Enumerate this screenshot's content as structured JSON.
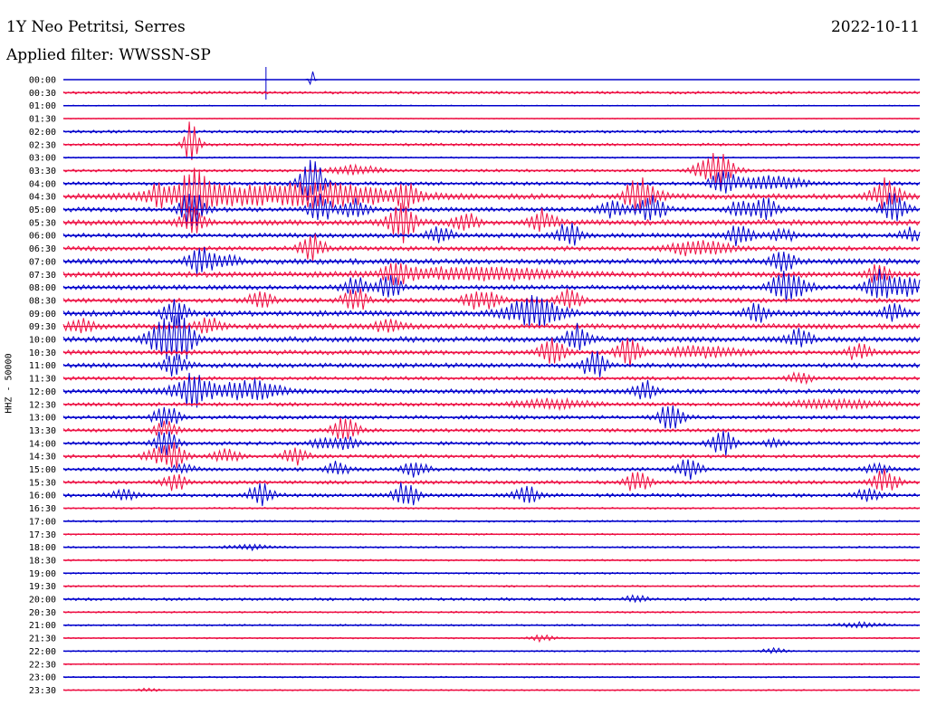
{
  "header": {
    "station": "1Y Neo Petritsi, Serres",
    "date": "2022-10-11",
    "filter": "Applied filter: WWSSN-SP"
  },
  "chart_data": {
    "type": "line",
    "title": "1Y Neo Petritsi, Serres",
    "ylabel": "HHZ - 50000",
    "colors": [
      "#0000cc",
      "#ee1144"
    ],
    "times": [
      "00:00",
      "00:30",
      "01:00",
      "01:30",
      "02:00",
      "02:30",
      "03:00",
      "03:30",
      "04:00",
      "04:30",
      "05:00",
      "05:30",
      "06:00",
      "06:30",
      "07:00",
      "07:30",
      "08:00",
      "08:30",
      "09:00",
      "09:30",
      "10:00",
      "10:30",
      "11:00",
      "11:30",
      "12:00",
      "12:30",
      "13:00",
      "13:30",
      "14:00",
      "14:30",
      "15:00",
      "15:30",
      "16:00",
      "16:30",
      "17:00",
      "17:30",
      "18:00",
      "18:30",
      "19:00",
      "19:30",
      "20:00",
      "20:30",
      "21:00",
      "21:30",
      "22:00",
      "22:30",
      "23:00",
      "23:30"
    ],
    "noise": [
      0,
      1.5,
      0.5,
      0.5,
      1.5,
      1.5,
      0.8,
      1.5,
      2,
      3,
      2.5,
      3,
      2.5,
      2.5,
      3,
      3,
      2.5,
      2.5,
      3,
      3,
      3,
      2.5,
      2.5,
      2,
      2.5,
      2,
      2,
      2,
      2,
      2,
      2,
      2,
      2,
      1,
      1,
      1,
      1,
      1,
      1,
      1,
      1.5,
      1,
      1,
      0.8,
      0.8,
      0.8,
      0.8,
      0.8
    ],
    "events": [
      [
        [
          0.29,
          -12,
          0,
          0.002
        ]
      ],
      [],
      [],
      [],
      [],
      [
        [
          0.15,
          28,
          6,
          0.006
        ]
      ],
      [],
      [
        [
          0.34,
          6,
          3,
          0.02
        ],
        [
          0.76,
          22,
          12,
          0.015
        ]
      ],
      [
        [
          0.29,
          28,
          8,
          0.01
        ],
        [
          0.77,
          14,
          8,
          0.01
        ],
        [
          0.8,
          6,
          4,
          0.02
        ],
        [
          0.84,
          7,
          4,
          0.02
        ]
      ],
      [
        [
          0.11,
          12,
          8,
          0.01
        ],
        [
          0.15,
          25,
          12,
          0.012
        ],
        [
          0.17,
          8,
          4,
          0.02
        ],
        [
          0.25,
          10,
          4,
          0.09
        ],
        [
          0.32,
          8,
          4,
          0.05
        ],
        [
          0.4,
          12,
          10,
          0.01
        ],
        [
          0.67,
          22,
          14,
          0.01
        ],
        [
          0.69,
          6,
          5,
          0.01
        ],
        [
          0.96,
          20,
          12,
          0.012
        ]
      ],
      [
        [
          0.15,
          25,
          15,
          0.01
        ],
        [
          0.3,
          16,
          10,
          0.01
        ],
        [
          0.34,
          12,
          8,
          0.01
        ],
        [
          0.64,
          12,
          6,
          0.01
        ],
        [
          0.68,
          8,
          6,
          0.01
        ],
        [
          0.69,
          10,
          6,
          0.01
        ],
        [
          0.79,
          10,
          8,
          0.01
        ],
        [
          0.82,
          12,
          8,
          0.01
        ],
        [
          0.97,
          20,
          4,
          0.01
        ]
      ],
      [
        [
          0.15,
          18,
          12,
          0.01
        ],
        [
          0.39,
          16,
          12,
          0.01
        ],
        [
          0.4,
          12,
          8,
          0.01
        ],
        [
          0.47,
          10,
          6,
          0.01
        ],
        [
          0.56,
          14,
          10,
          0.01
        ]
      ],
      [
        [
          0.44,
          12,
          8,
          0.01
        ],
        [
          0.59,
          14,
          10,
          0.01
        ],
        [
          0.79,
          14,
          10,
          0.01
        ],
        [
          0.84,
          8,
          4,
          0.01
        ],
        [
          0.99,
          8,
          4,
          0.01
        ]
      ],
      [
        [
          0.29,
          16,
          12,
          0.01
        ],
        [
          0.73,
          6,
          3,
          0.02
        ],
        [
          0.76,
          5,
          3,
          0.02
        ]
      ],
      [
        [
          0.16,
          18,
          10,
          0.01
        ],
        [
          0.19,
          8,
          5,
          0.01
        ],
        [
          0.84,
          14,
          10,
          0.01
        ]
      ],
      [
        [
          0.39,
          12,
          8,
          0.01
        ],
        [
          0.45,
          6,
          4,
          0.06
        ],
        [
          0.53,
          4,
          3,
          0.04
        ],
        [
          0.95,
          10,
          6,
          0.01
        ]
      ],
      [
        [
          0.34,
          12,
          8,
          0.01
        ],
        [
          0.38,
          16,
          12,
          0.01
        ],
        [
          0.84,
          20,
          12,
          0.01
        ],
        [
          0.86,
          10,
          6,
          0.01
        ],
        [
          0.95,
          18,
          12,
          0.01
        ],
        [
          0.97,
          10,
          8,
          0.01
        ],
        [
          0.99,
          10,
          8,
          0.01
        ]
      ],
      [
        [
          0.23,
          12,
          8,
          0.01
        ],
        [
          0.34,
          16,
          12,
          0.01
        ],
        [
          0.48,
          10,
          6,
          0.01
        ],
        [
          0.5,
          8,
          5,
          0.01
        ],
        [
          0.59,
          12,
          8,
          0.01
        ]
      ],
      [
        [
          0.13,
          16,
          12,
          0.01
        ],
        [
          0.54,
          12,
          10,
          0.02
        ],
        [
          0.56,
          10,
          8,
          0.02
        ],
        [
          0.81,
          12,
          10,
          0.01
        ],
        [
          0.97,
          10,
          8,
          0.01
        ]
      ],
      [
        [
          0.02,
          8,
          4,
          0.01
        ],
        [
          0.17,
          10,
          8,
          0.01
        ],
        [
          0.38,
          8,
          5,
          0.01
        ]
      ],
      [
        [
          0.12,
          22,
          18,
          0.015
        ],
        [
          0.14,
          20,
          12,
          0.01
        ],
        [
          0.6,
          16,
          10,
          0.01
        ],
        [
          0.86,
          12,
          8,
          0.01
        ]
      ],
      [
        [
          0.57,
          18,
          14,
          0.01
        ],
        [
          0.66,
          16,
          12,
          0.01
        ],
        [
          0.73,
          6,
          3,
          0.02
        ],
        [
          0.77,
          5,
          3,
          0.02
        ],
        [
          0.93,
          10,
          8,
          0.01
        ]
      ],
      [
        [
          0.13,
          14,
          10,
          0.01
        ],
        [
          0.62,
          16,
          12,
          0.01
        ]
      ],
      [
        [
          0.86,
          6,
          4,
          0.01
        ]
      ],
      [
        [
          0.15,
          16,
          12,
          0.01
        ],
        [
          0.17,
          8,
          5,
          0.04
        ],
        [
          0.23,
          10,
          8,
          0.02
        ],
        [
          0.68,
          12,
          8,
          0.01
        ]
      ],
      [
        [
          0.57,
          6,
          4,
          0.03
        ],
        [
          0.9,
          5,
          3,
          0.04
        ]
      ],
      [
        [
          0.12,
          16,
          10,
          0.01
        ],
        [
          0.71,
          18,
          12,
          0.01
        ]
      ],
      [
        [
          0.12,
          12,
          8,
          0.01
        ],
        [
          0.33,
          16,
          12,
          0.01
        ]
      ],
      [
        [
          0.12,
          16,
          10,
          0.01
        ],
        [
          0.3,
          6,
          4,
          0.01
        ],
        [
          0.33,
          10,
          8,
          0.01
        ],
        [
          0.77,
          14,
          10,
          0.01
        ],
        [
          0.83,
          4,
          3,
          0.01
        ]
      ],
      [
        [
          0.11,
          10,
          8,
          0.01
        ],
        [
          0.13,
          14,
          10,
          0.01
        ],
        [
          0.19,
          10,
          6,
          0.01
        ],
        [
          0.27,
          12,
          8,
          0.01
        ]
      ],
      [
        [
          0.14,
          6,
          4,
          0.01
        ],
        [
          0.32,
          8,
          5,
          0.01
        ],
        [
          0.41,
          10,
          8,
          0.01
        ],
        [
          0.73,
          12,
          8,
          0.01
        ],
        [
          0.95,
          6,
          4,
          0.01
        ]
      ],
      [
        [
          0.13,
          10,
          6,
          0.01
        ],
        [
          0.67,
          14,
          10,
          0.01
        ],
        [
          0.96,
          16,
          10,
          0.01
        ]
      ],
      [
        [
          0.07,
          6,
          4,
          0.01
        ],
        [
          0.23,
          14,
          10,
          0.01
        ],
        [
          0.4,
          16,
          12,
          0.01
        ],
        [
          0.54,
          12,
          8,
          0.01
        ],
        [
          0.94,
          8,
          5,
          0.01
        ]
      ],
      [],
      [],
      [],
      [
        [
          0.22,
          3,
          2,
          0.02
        ]
      ],
      [],
      [],
      [],
      [
        [
          0.67,
          4,
          3,
          0.01
        ]
      ],
      [],
      [
        [
          0.93,
          3,
          2,
          0.02
        ]
      ],
      [
        [
          0.56,
          4,
          3,
          0.01
        ]
      ],
      [
        [
          0.83,
          3,
          2,
          0.01
        ]
      ],
      [],
      [],
      [
        [
          0.1,
          2,
          2,
          0.01
        ]
      ]
    ]
  }
}
